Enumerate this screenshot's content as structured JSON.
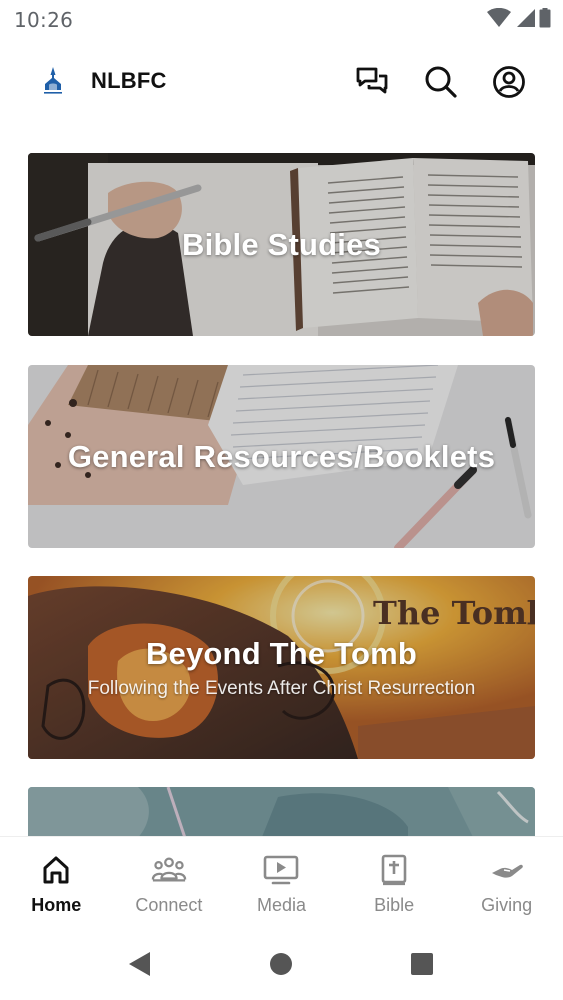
{
  "status_bar": {
    "time": "10:26",
    "icons": [
      "wifi-icon",
      "cellular-signal-icon",
      "battery-icon"
    ]
  },
  "app_bar": {
    "title": "NLBFC",
    "actions": [
      "chat-icon",
      "search-icon",
      "account-icon"
    ]
  },
  "cards": [
    {
      "title": "Bible Studies",
      "subtitle": ""
    },
    {
      "title": "General Resources/Booklets",
      "subtitle": ""
    },
    {
      "title": "Beyond The Tomb",
      "subtitle": "Following the Events After Christ Resurrection",
      "art_text": "The Tomb"
    },
    {
      "title": "",
      "subtitle": ""
    }
  ],
  "bottom_nav": {
    "items": [
      {
        "label": "Home",
        "icon": "home-icon",
        "active": true
      },
      {
        "label": "Connect",
        "icon": "people-icon",
        "active": false
      },
      {
        "label": "Media",
        "icon": "play-video-icon",
        "active": false
      },
      {
        "label": "Bible",
        "icon": "bible-icon",
        "active": false
      },
      {
        "label": "Giving",
        "icon": "giving-hand-icon",
        "active": false
      }
    ]
  },
  "colors": {
    "accent": "#111111",
    "inactive": "#8a8a8a",
    "logo_blue": "#1f5fa8"
  }
}
